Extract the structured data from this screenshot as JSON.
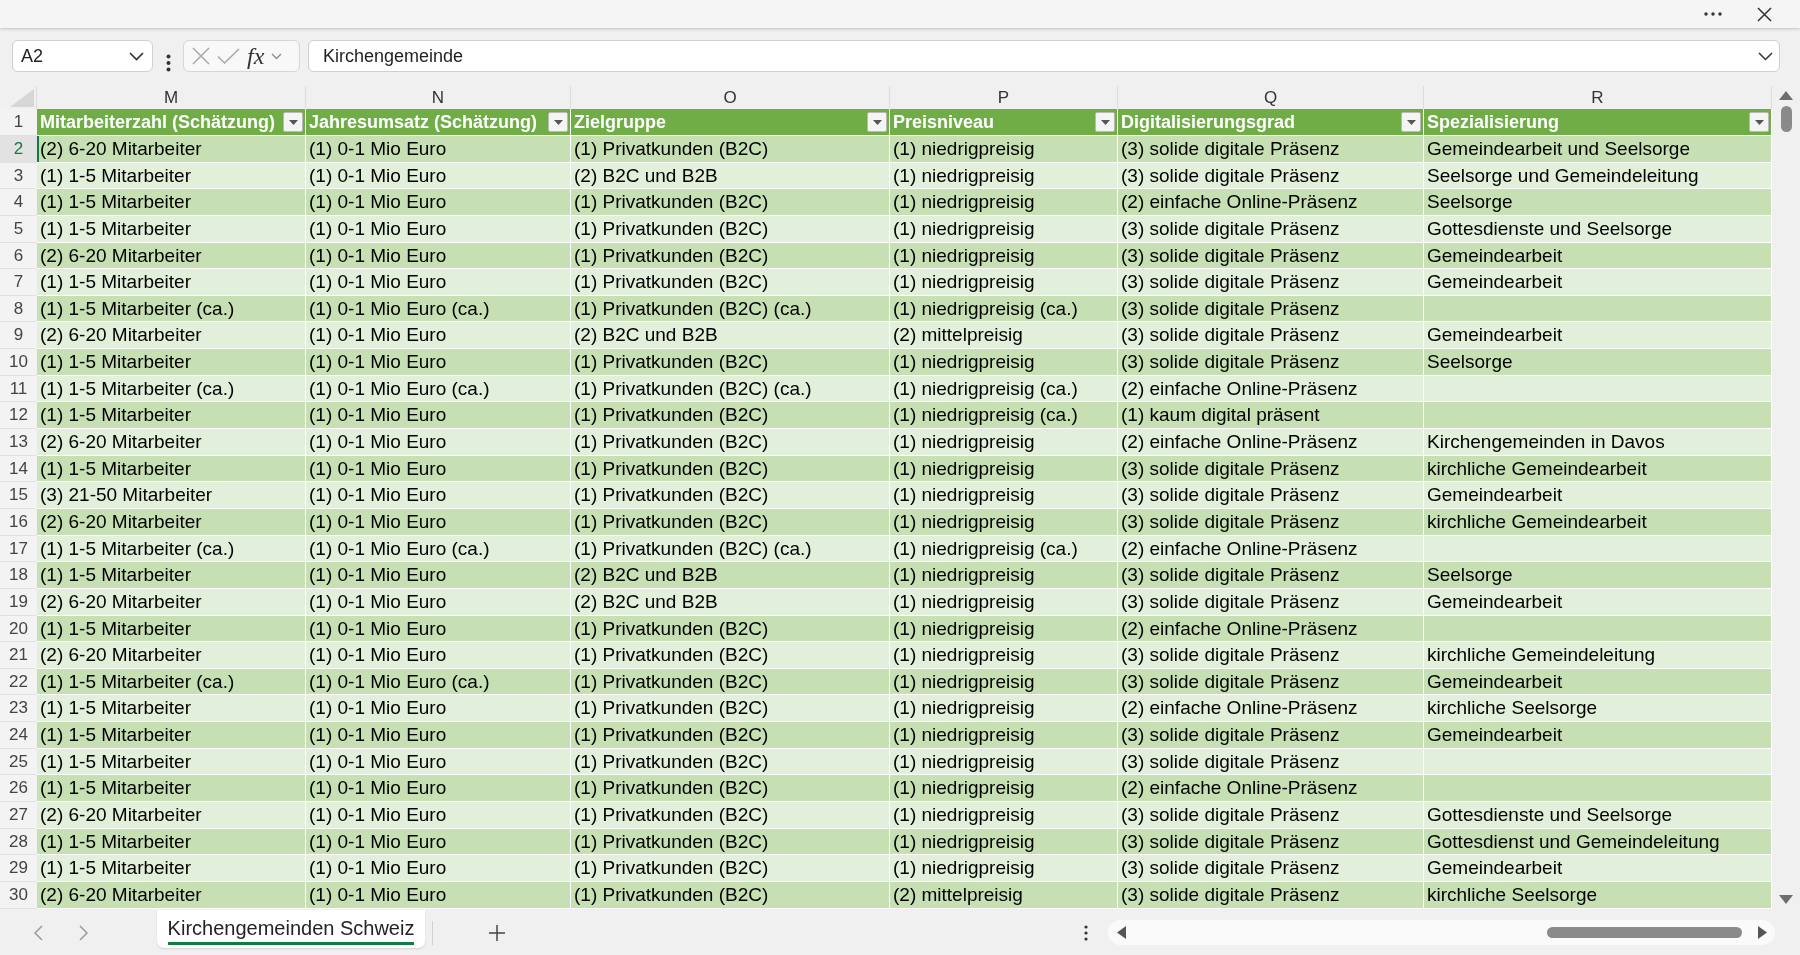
{
  "formula_bar": {
    "name_box": "A2",
    "function_label": "fx",
    "formula": "Kirchengemeinde"
  },
  "sheet": {
    "columns": [
      {
        "letter": "M",
        "header": "Mitarbeiterzahl (Schätzung)"
      },
      {
        "letter": "N",
        "header": "Jahresumsatz (Schätzung)"
      },
      {
        "letter": "O",
        "header": "Zielgruppe"
      },
      {
        "letter": "P",
        "header": "Preisniveau"
      },
      {
        "letter": "Q",
        "header": "Digitalisierungsgrad"
      },
      {
        "letter": "R",
        "header": "Spezialisierung"
      }
    ],
    "header_row_number": "1",
    "rows": [
      {
        "number": "2",
        "selected": true,
        "cells": [
          "(2) 6-20 Mitarbeiter",
          "(1) 0-1 Mio Euro",
          "(1) Privatkunden (B2C)",
          "(1) niedrigpreisig",
          "(3) solide digitale Präsenz",
          "Gemeindearbeit und Seelsorge"
        ]
      },
      {
        "number": "3",
        "selected": false,
        "cells": [
          "(1) 1-5 Mitarbeiter",
          "(1) 0-1 Mio Euro",
          "(2) B2C und B2B",
          "(1) niedrigpreisig",
          "(3) solide digitale Präsenz",
          "Seelsorge und Gemeindeleitung"
        ]
      },
      {
        "number": "4",
        "selected": false,
        "cells": [
          "(1) 1-5 Mitarbeiter",
          "(1) 0-1 Mio Euro",
          "(1) Privatkunden (B2C)",
          "(1) niedrigpreisig",
          "(2) einfache Online-Präsenz",
          "Seelsorge"
        ]
      },
      {
        "number": "5",
        "selected": false,
        "cells": [
          "(1) 1-5 Mitarbeiter",
          "(1) 0-1 Mio Euro",
          "(1) Privatkunden (B2C)",
          "(1) niedrigpreisig",
          "(3) solide digitale Präsenz",
          "Gottesdienste und Seelsorge"
        ]
      },
      {
        "number": "6",
        "selected": false,
        "cells": [
          "(2) 6-20 Mitarbeiter",
          "(1) 0-1 Mio Euro",
          "(1) Privatkunden (B2C)",
          "(1) niedrigpreisig",
          "(3) solide digitale Präsenz",
          "Gemeindearbeit"
        ]
      },
      {
        "number": "7",
        "selected": false,
        "cells": [
          "(1) 1-5 Mitarbeiter",
          "(1) 0-1 Mio Euro",
          "(1) Privatkunden (B2C)",
          "(1) niedrigpreisig",
          "(3) solide digitale Präsenz",
          "Gemeindearbeit"
        ]
      },
      {
        "number": "8",
        "selected": false,
        "cells": [
          "(1) 1-5 Mitarbeiter (ca.)",
          "(1) 0-1 Mio Euro (ca.)",
          "(1) Privatkunden (B2C) (ca.)",
          "(1) niedrigpreisig (ca.)",
          "(3) solide digitale Präsenz"
        ]
      },
      {
        "number": "9",
        "selected": false,
        "cells": [
          "(2) 6-20 Mitarbeiter",
          "(1) 0-1 Mio Euro",
          "(2) B2C und B2B",
          "(2) mittelpreisig",
          "(3) solide digitale Präsenz",
          "Gemeindearbeit"
        ]
      },
      {
        "number": "10",
        "selected": false,
        "cells": [
          "(1) 1-5 Mitarbeiter",
          "(1) 0-1 Mio Euro",
          "(1) Privatkunden (B2C)",
          "(1) niedrigpreisig",
          "(3) solide digitale Präsenz",
          "Seelsorge"
        ]
      },
      {
        "number": "11",
        "selected": false,
        "cells": [
          "(1) 1-5 Mitarbeiter (ca.)",
          "(1) 0-1 Mio Euro (ca.)",
          "(1) Privatkunden (B2C) (ca.)",
          "(1) niedrigpreisig (ca.)",
          "(2) einfache Online-Präsenz"
        ]
      },
      {
        "number": "12",
        "selected": false,
        "cells": [
          "(1) 1-5 Mitarbeiter",
          "(1) 0-1 Mio Euro",
          "(1) Privatkunden (B2C)",
          "(1) niedrigpreisig (ca.)",
          "(1) kaum digital präsent"
        ]
      },
      {
        "number": "13",
        "selected": false,
        "cells": [
          "(2) 6-20 Mitarbeiter",
          "(1) 0-1 Mio Euro",
          "(1) Privatkunden (B2C)",
          "(1) niedrigpreisig",
          "(2) einfache Online-Präsenz",
          "Kirchengemeinden in Davos"
        ]
      },
      {
        "number": "14",
        "selected": false,
        "cells": [
          "(1) 1-5 Mitarbeiter",
          "(1) 0-1 Mio Euro",
          "(1) Privatkunden (B2C)",
          "(1) niedrigpreisig",
          "(3) solide digitale Präsenz",
          "kirchliche Gemeindearbeit"
        ]
      },
      {
        "number": "15",
        "selected": false,
        "cells": [
          "(3) 21-50 Mitarbeiter",
          "(1) 0-1 Mio Euro",
          "(1) Privatkunden (B2C)",
          "(1) niedrigpreisig",
          "(3) solide digitale Präsenz",
          "Gemeindearbeit"
        ]
      },
      {
        "number": "16",
        "selected": false,
        "cells": [
          "(2) 6-20 Mitarbeiter",
          "(1) 0-1 Mio Euro",
          "(1) Privatkunden (B2C)",
          "(1) niedrigpreisig",
          "(3) solide digitale Präsenz",
          "kirchliche Gemeindearbeit"
        ]
      },
      {
        "number": "17",
        "selected": false,
        "cells": [
          "(1) 1-5 Mitarbeiter (ca.)",
          "(1) 0-1 Mio Euro (ca.)",
          "(1) Privatkunden (B2C) (ca.)",
          "(1) niedrigpreisig (ca.)",
          "(2) einfache Online-Präsenz"
        ]
      },
      {
        "number": "18",
        "selected": false,
        "cells": [
          "(1) 1-5 Mitarbeiter",
          "(1) 0-1 Mio Euro",
          "(2) B2C und B2B",
          "(1) niedrigpreisig",
          "(3) solide digitale Präsenz",
          "Seelsorge"
        ]
      },
      {
        "number": "19",
        "selected": false,
        "cells": [
          "(2) 6-20 Mitarbeiter",
          "(1) 0-1 Mio Euro",
          "(2) B2C und B2B",
          "(1) niedrigpreisig",
          "(3) solide digitale Präsenz",
          "Gemeindearbeit"
        ]
      },
      {
        "number": "20",
        "selected": false,
        "cells": [
          "(1) 1-5 Mitarbeiter",
          "(1) 0-1 Mio Euro",
          "(1) Privatkunden (B2C)",
          "(1) niedrigpreisig",
          "(2) einfache Online-Präsenz"
        ]
      },
      {
        "number": "21",
        "selected": false,
        "cells": [
          "(2) 6-20 Mitarbeiter",
          "(1) 0-1 Mio Euro",
          "(1) Privatkunden (B2C)",
          "(1) niedrigpreisig",
          "(3) solide digitale Präsenz",
          "kirchliche Gemeindeleitung"
        ]
      },
      {
        "number": "22",
        "selected": false,
        "cells": [
          "(1) 1-5 Mitarbeiter (ca.)",
          "(1) 0-1 Mio Euro (ca.)",
          "(1) Privatkunden (B2C)",
          "(1) niedrigpreisig",
          "(3) solide digitale Präsenz",
          "Gemeindearbeit"
        ]
      },
      {
        "number": "23",
        "selected": false,
        "cells": [
          "(1) 1-5 Mitarbeiter",
          "(1) 0-1 Mio Euro",
          "(1) Privatkunden (B2C)",
          "(1) niedrigpreisig",
          "(2) einfache Online-Präsenz",
          "kirchliche Seelsorge"
        ]
      },
      {
        "number": "24",
        "selected": false,
        "cells": [
          "(1) 1-5 Mitarbeiter",
          "(1) 0-1 Mio Euro",
          "(1) Privatkunden (B2C)",
          "(1) niedrigpreisig",
          "(3) solide digitale Präsenz",
          "Gemeindearbeit"
        ]
      },
      {
        "number": "25",
        "selected": false,
        "cells": [
          "(1) 1-5 Mitarbeiter",
          "(1) 0-1 Mio Euro",
          "(1) Privatkunden (B2C)",
          "(1) niedrigpreisig",
          "(3) solide digitale Präsenz"
        ]
      },
      {
        "number": "26",
        "selected": false,
        "cells": [
          "(1) 1-5 Mitarbeiter",
          "(1) 0-1 Mio Euro",
          "(1) Privatkunden (B2C)",
          "(1) niedrigpreisig",
          "(2) einfache Online-Präsenz"
        ]
      },
      {
        "number": "27",
        "selected": false,
        "cells": [
          "(2) 6-20 Mitarbeiter",
          "(1) 0-1 Mio Euro",
          "(1) Privatkunden (B2C)",
          "(1) niedrigpreisig",
          "(3) solide digitale Präsenz",
          "Gottesdienste und Seelsorge"
        ]
      },
      {
        "number": "28",
        "selected": false,
        "cells": [
          "(1) 1-5 Mitarbeiter",
          "(1) 0-1 Mio Euro",
          "(1) Privatkunden (B2C)",
          "(1) niedrigpreisig",
          "(3) solide digitale Präsenz",
          "Gottesdienst und Gemeindeleitung"
        ]
      },
      {
        "number": "29",
        "selected": false,
        "cells": [
          "(1) 1-5 Mitarbeiter",
          "(1) 0-1 Mio Euro",
          "(1) Privatkunden (B2C)",
          "(1) niedrigpreisig",
          "(3) solide digitale Präsenz",
          "Gemeindearbeit"
        ]
      },
      {
        "number": "30",
        "selected": false,
        "cells": [
          "(2) 6-20 Mitarbeiter",
          "(1) 0-1 Mio Euro",
          "(1) Privatkunden (B2C)",
          "(2) mittelpreisig",
          "(3) solide digitale Präsenz",
          "kirchliche Seelsorge"
        ]
      }
    ]
  },
  "sheet_tabs": [
    {
      "label": "Kirchengemeinden Schweiz",
      "selected": true
    }
  ]
}
